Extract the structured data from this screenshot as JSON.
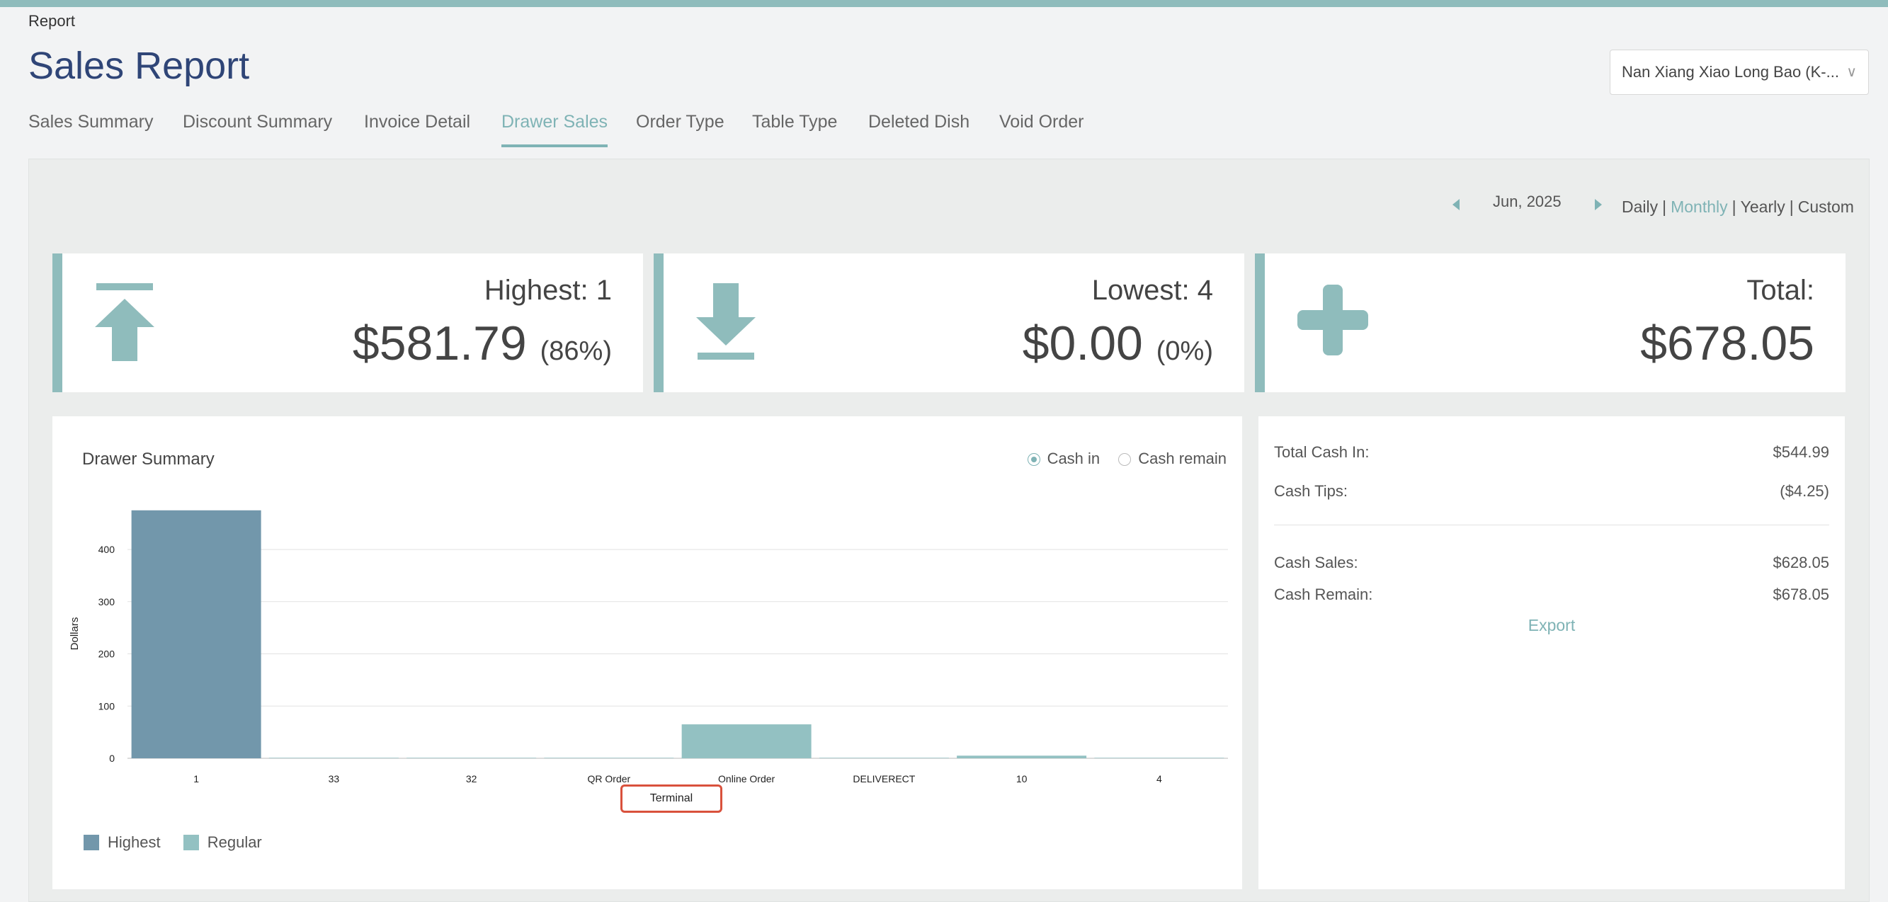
{
  "breadcrumb": "Report",
  "page_title": "Sales Report",
  "store_select": {
    "value": "Nan Xiang Xiao Long Bao (K-..."
  },
  "tabs": [
    {
      "label": "Sales Summary",
      "active": false
    },
    {
      "label": "Discount Summary",
      "active": false
    },
    {
      "label": "Invoice Detail",
      "active": false
    },
    {
      "label": "Drawer Sales",
      "active": true
    },
    {
      "label": "Order Type",
      "active": false
    },
    {
      "label": "Table Type",
      "active": false
    },
    {
      "label": "Deleted Dish",
      "active": false
    },
    {
      "label": "Void Order",
      "active": false
    }
  ],
  "period": {
    "month": "Jun, 2025",
    "options": [
      "Daily",
      "Monthly",
      "Yearly",
      "Custom"
    ],
    "active": "Monthly"
  },
  "cards": {
    "highest": {
      "label": "Highest: 1",
      "value": "$581.79",
      "pct": "(86%)",
      "icon": "arrow-up-bar-icon"
    },
    "lowest": {
      "label": "Lowest: 4",
      "value": "$0.00",
      "pct": "(0%)",
      "icon": "arrow-down-bar-icon"
    },
    "total": {
      "label": "Total:",
      "value": "$678.05",
      "icon": "plus-icon"
    }
  },
  "colors": {
    "accent": "#7fb3b5",
    "highest_bar": "#7297ab",
    "regular_bar": "#93c1c2"
  },
  "drawer_summary": {
    "title": "Drawer Summary",
    "radios": [
      {
        "label": "Cash in",
        "checked": true
      },
      {
        "label": "Cash remain",
        "checked": false
      }
    ]
  },
  "chart_data": {
    "type": "bar",
    "title": "Drawer Summary",
    "xlabel": "Terminal",
    "ylabel": "Dollars",
    "categories": [
      "1",
      "33",
      "32",
      "QR Order",
      "Online Order",
      "DELIVERECT",
      "10",
      "4"
    ],
    "values": [
      475,
      1,
      1,
      1,
      65,
      1,
      5,
      1
    ],
    "highlight_index": 0,
    "yticks": [
      0,
      100,
      200,
      300,
      400
    ],
    "ylim": [
      0,
      475
    ],
    "grid": true,
    "legend": [
      {
        "name": "Highest",
        "color": "#7297ab"
      },
      {
        "name": "Regular",
        "color": "#93c1c2"
      }
    ],
    "legend_position": "bottom-left"
  },
  "summary": {
    "total_cash_in": {
      "label": "Total Cash In:",
      "value": "$544.99"
    },
    "cash_tips": {
      "label": "Cash Tips:",
      "value": "($4.25)"
    },
    "cash_sales": {
      "label": "Cash Sales:",
      "value": "$628.05"
    },
    "cash_remain": {
      "label": "Cash Remain:",
      "value": "$678.05"
    },
    "export_label": "Export"
  }
}
